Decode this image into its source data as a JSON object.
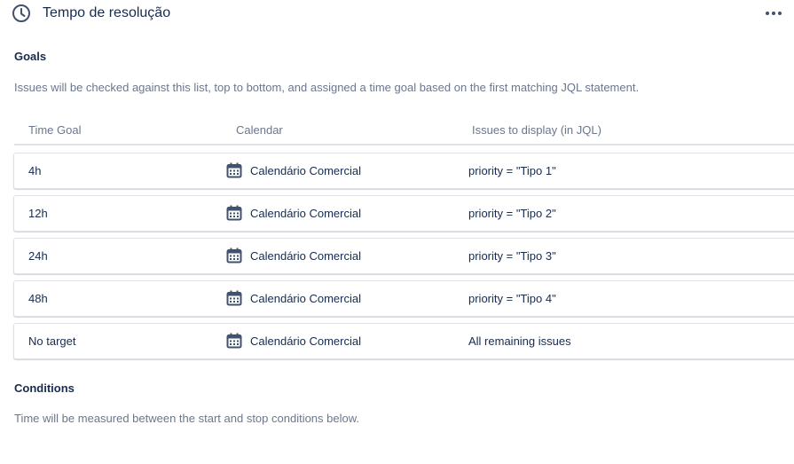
{
  "header": {
    "title": "Tempo de resolução",
    "icon": "clock-icon",
    "more_icon": "more-horizontal-icon"
  },
  "goals": {
    "title": "Goals",
    "description": "Issues will be checked against this list, top to bottom, and assigned a time goal based on the first matching JQL statement.",
    "columns": {
      "time_goal": "Time Goal",
      "calendar": "Calendar",
      "jql": "Issues to display (in JQL)"
    },
    "rows": [
      {
        "time_goal": "4h",
        "calendar": "Calendário Comercial",
        "jql": "priority = \"Tipo 1\""
      },
      {
        "time_goal": "12h",
        "calendar": "Calendário Comercial",
        "jql": "priority = \"Tipo 2\""
      },
      {
        "time_goal": "24h",
        "calendar": "Calendário Comercial",
        "jql": "priority = \"Tipo 3\""
      },
      {
        "time_goal": "48h",
        "calendar": "Calendário Comercial",
        "jql": "priority = \"Tipo 4\""
      },
      {
        "time_goal": "No target",
        "calendar": "Calendário Comercial",
        "jql": "All remaining issues"
      }
    ]
  },
  "conditions": {
    "title": "Conditions",
    "description": "Time will be measured between the start and stop conditions below."
  },
  "colors": {
    "text_primary": "#172b4d",
    "text_secondary": "#6b778c",
    "border": "#dfe1e6",
    "icon": "#42526e"
  }
}
